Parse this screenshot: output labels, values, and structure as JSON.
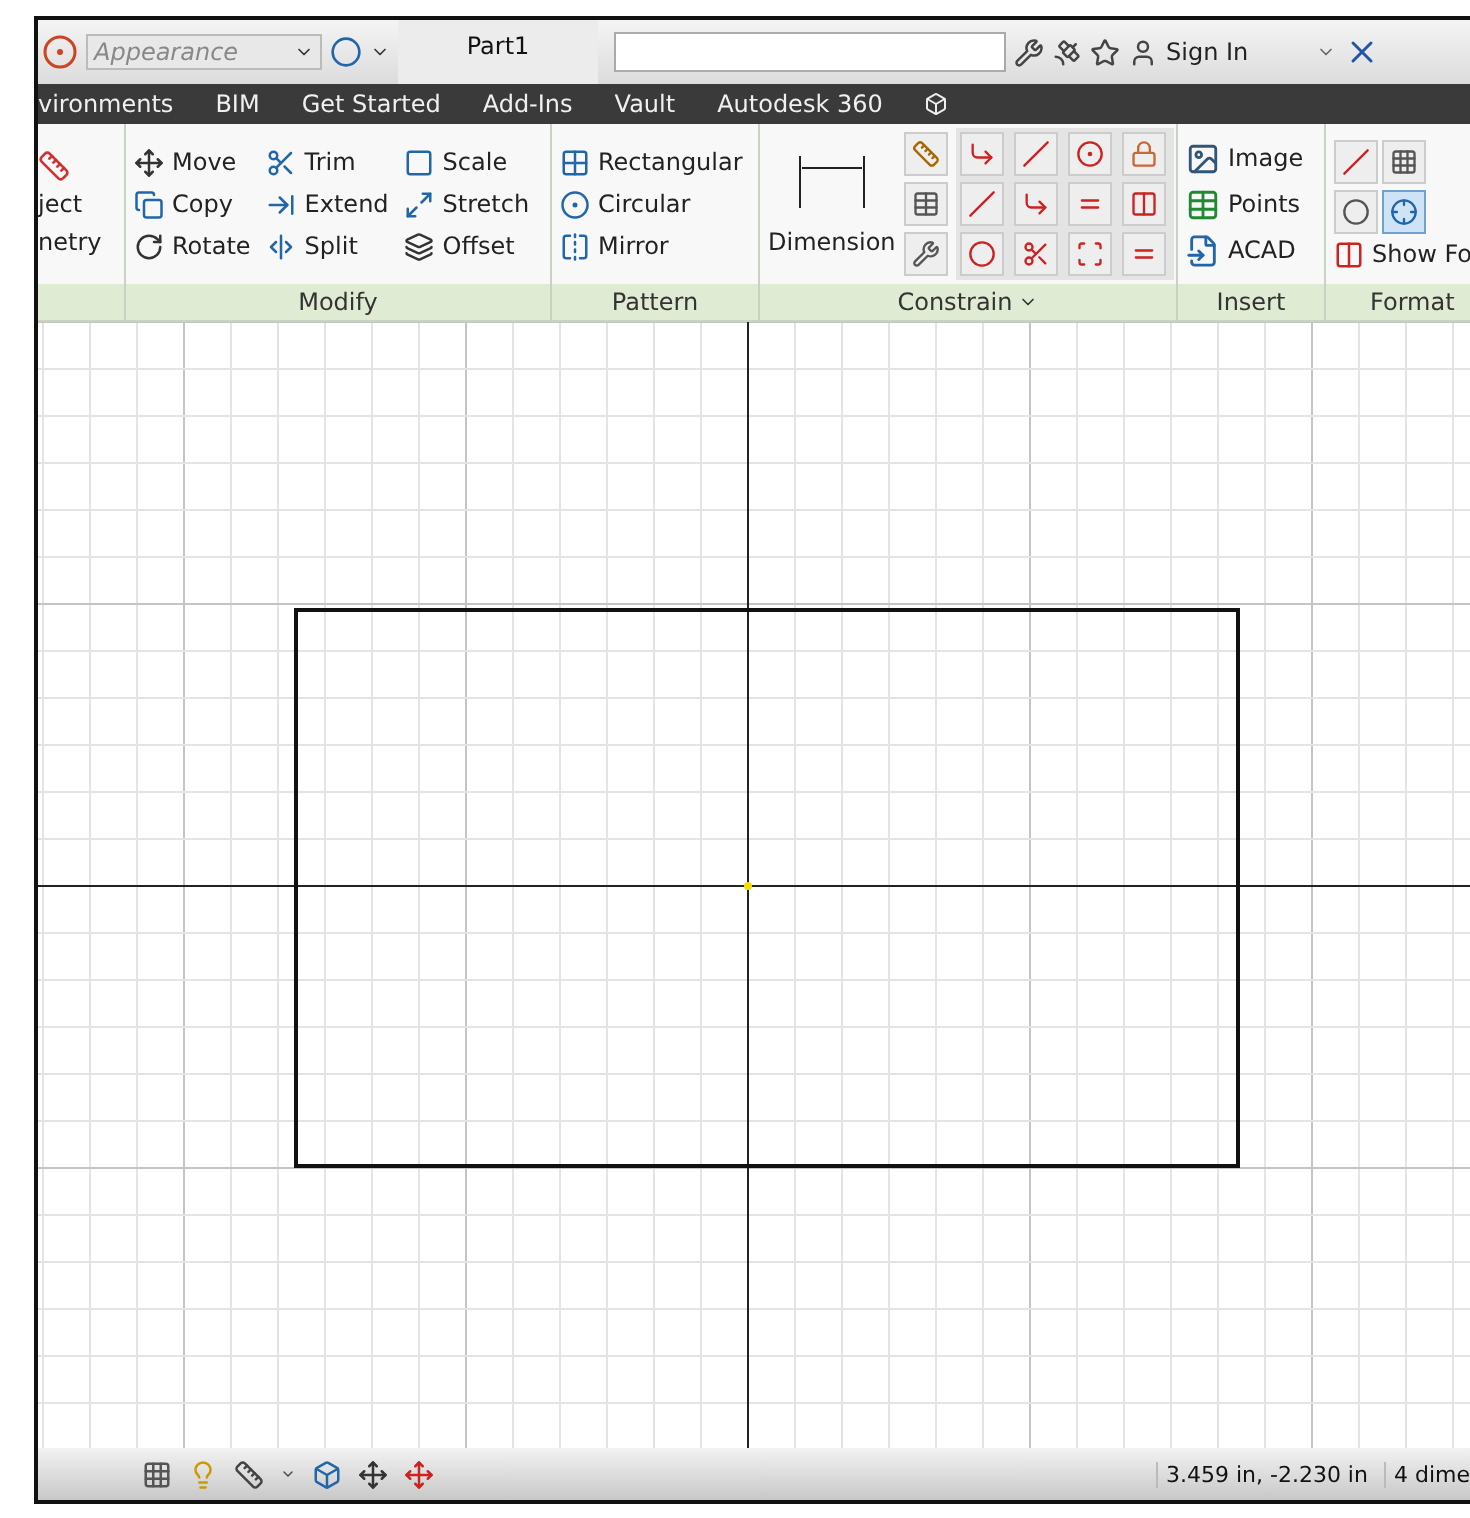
{
  "title_bar": {
    "appearance": "Appearance",
    "document_tab": "Part1",
    "sign_in": "Sign In"
  },
  "menu_tabs": [
    {
      "label": "vironments"
    },
    {
      "label": "BIM"
    },
    {
      "label": "Get Started"
    },
    {
      "label": "Add-Ins"
    },
    {
      "label": "Vault"
    },
    {
      "label": "Autodesk 360"
    }
  ],
  "project_geometry_partial": {
    "lines": [
      "ject",
      "netry"
    ]
  },
  "modify": {
    "label": "Modify",
    "tools": [
      "Move",
      "Trim",
      "Scale",
      "Copy",
      "Extend",
      "Stretch",
      "Rotate",
      "Split",
      "Offset"
    ]
  },
  "pattern": {
    "label": "Pattern",
    "tools": [
      "Rectangular",
      "Circular",
      "Mirror"
    ]
  },
  "constrain": {
    "label": "Constrain",
    "tool": "Dimension"
  },
  "insert": {
    "label": "Insert",
    "tools": [
      "Image",
      "Points",
      "ACAD"
    ]
  },
  "format": {
    "label": "Format",
    "tool": "Show Fo"
  },
  "status_bar": {
    "coordinates": "3.459 in, -2.230 in",
    "dimensions": "4 dime"
  }
}
